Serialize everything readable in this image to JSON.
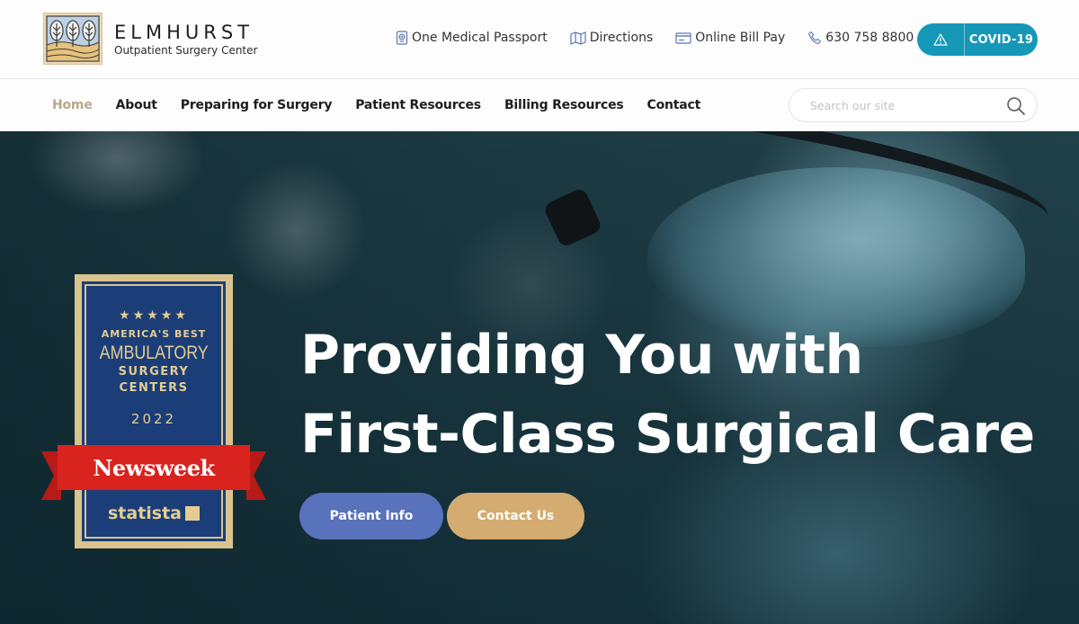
{
  "brand": {
    "name": "ELMHURST",
    "subtitle": "Outpatient Surgery Center"
  },
  "utility_links": [
    {
      "label": "One Medical Passport",
      "icon": "passport-icon"
    },
    {
      "label": "Directions",
      "icon": "map-icon"
    },
    {
      "label": "Online Bill Pay",
      "icon": "credit-card-icon"
    },
    {
      "label": "630 758 8800",
      "icon": "phone-icon"
    }
  ],
  "covid_button": {
    "label": "COVID-19",
    "icon": "warning-icon",
    "color": "#1598b8"
  },
  "nav": {
    "items": [
      {
        "label": "Home",
        "active": true
      },
      {
        "label": "About"
      },
      {
        "label": "Preparing for Surgery"
      },
      {
        "label": "Patient Resources"
      },
      {
        "label": "Billing Resources"
      },
      {
        "label": "Contact"
      }
    ],
    "active_color": "#b7a88a"
  },
  "search": {
    "placeholder": "Search our site",
    "value": ""
  },
  "hero": {
    "headline_line1": "Providing You with",
    "headline_line2": "First-Class Surgical Care",
    "buttons": [
      {
        "label": "Patient Info",
        "color": "#5972bc"
      },
      {
        "label": "Contact Us",
        "color": "#d4ab71"
      }
    ],
    "award_badge": {
      "stars": "★★★★★",
      "line1": "AMERICA'S BEST",
      "line2": "AMBULATORY",
      "line3": "SURGERY",
      "line4": "CENTERS",
      "year": "2022",
      "ribbon": "Newsweek",
      "partner": "statista"
    }
  }
}
